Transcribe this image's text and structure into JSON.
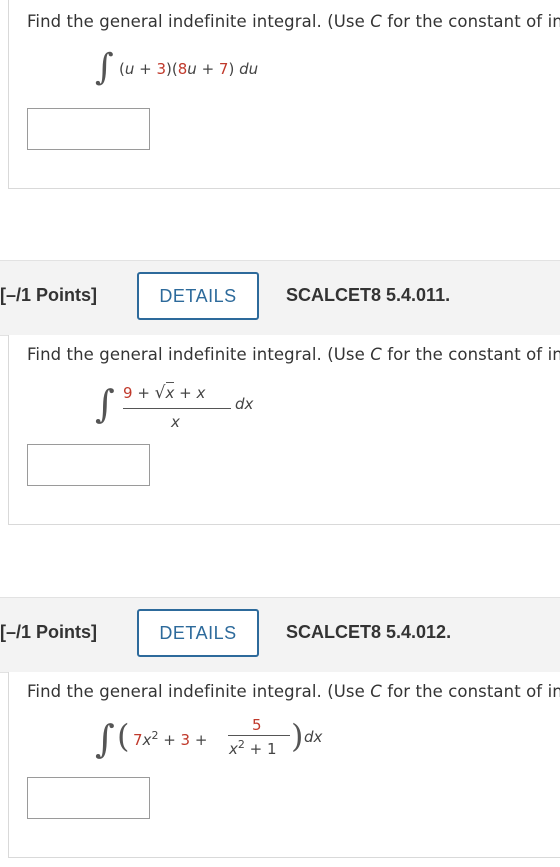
{
  "questions": [
    {
      "prompt_before": "Find the general indefinite integral. (Use ",
      "prompt_var": "C",
      "prompt_after": " for the constant of int",
      "integrand": {
        "paren_open": "(",
        "u1": "u",
        "plus1": " + ",
        "n3": "3",
        "close_open": ")(",
        "n8": "8",
        "u2": "u",
        "plus2": " + ",
        "n7": "7",
        "paren_close": ")",
        "du": "du"
      }
    },
    {
      "points": "[–/1 Points]",
      "details": "DETAILS",
      "code": "SCALCET8 5.4.011.",
      "prompt_before": "Find the general indefinite integral. (Use ",
      "prompt_var": "C",
      "prompt_after": " for the constant of int",
      "integrand": {
        "n9": "9",
        "plus_a": " + ",
        "radical": "√",
        "x_in_root": "x",
        "plus_b": " + ",
        "x_tail": "x",
        "denominator": "x",
        "dx": "dx"
      }
    },
    {
      "points": "[–/1 Points]",
      "details": "DETAILS",
      "code": "SCALCET8 5.4.012.",
      "prompt_before": "Find the general indefinite integral. (Use ",
      "prompt_var": "C",
      "prompt_after": " for the constant of int",
      "integrand": {
        "n7": "7",
        "x": "x",
        "exp2": "2",
        "plus_a": " + ",
        "n3": "3",
        "plus_b": " + ",
        "numerator": "5",
        "den_x": "x",
        "den_exp": "2",
        "den_plus": " + ",
        "den_1": "1",
        "dx": "dx"
      }
    }
  ],
  "symbols": {
    "integral": "∫",
    "lparen": "(",
    "rparen": ")"
  }
}
